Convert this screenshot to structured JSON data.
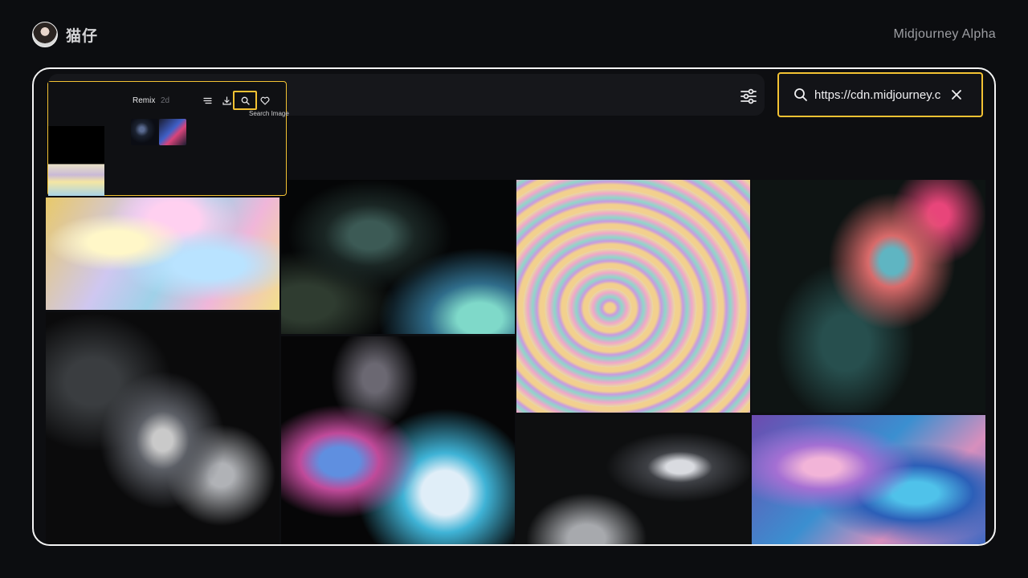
{
  "header": {
    "author_name": "猫仔",
    "brand": "Midjourney Alpha"
  },
  "toolbar": {
    "filter_icon": "sliders-icon",
    "search": {
      "value": "https://cdn.midjourney.c",
      "icon": "search-icon",
      "clear_icon": "close-icon"
    }
  },
  "popover": {
    "label": "Remix",
    "age": "2d",
    "tooltip": "Search Image",
    "icons": [
      "list-icon",
      "download-icon",
      "search-icon",
      "heart-icon"
    ]
  },
  "gallery": {
    "image_count": 8
  },
  "colors": {
    "background": "#0c0d10",
    "highlight": "#f3c233",
    "frame_border": "#f4f4f4"
  }
}
